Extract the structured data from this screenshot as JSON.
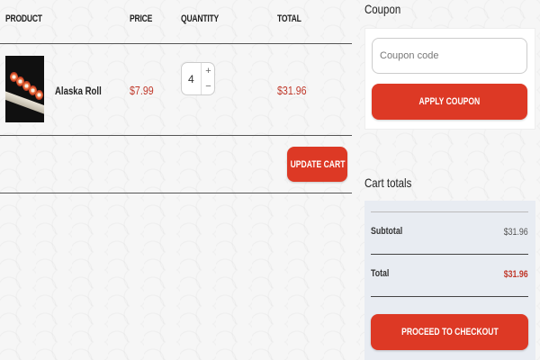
{
  "cart": {
    "columns": {
      "product": "Product",
      "price": "Price",
      "quantity": "Quantity",
      "total": "Total"
    },
    "items": [
      {
        "name": "Alaska Roll",
        "price": "$7.99",
        "quantity": "4",
        "total": "$31.96",
        "image_icon": "sushi-roll-photo"
      }
    ],
    "qty_plus": "+",
    "qty_minus": "−",
    "update_label": "Update cart"
  },
  "coupon": {
    "heading": "Coupon",
    "placeholder": "Coupon code",
    "value": "",
    "apply_label": "Apply coupon"
  },
  "totals": {
    "heading": "Cart totals",
    "subtotal_label": "Subtotal",
    "subtotal_value": "$31.96",
    "total_label": "Total",
    "total_value": "$31.96",
    "checkout_label": "Proceed to checkout"
  },
  "colors": {
    "accent": "#dd3925",
    "price": "#c0392b",
    "totals_panel": "#e8ecf2"
  }
}
